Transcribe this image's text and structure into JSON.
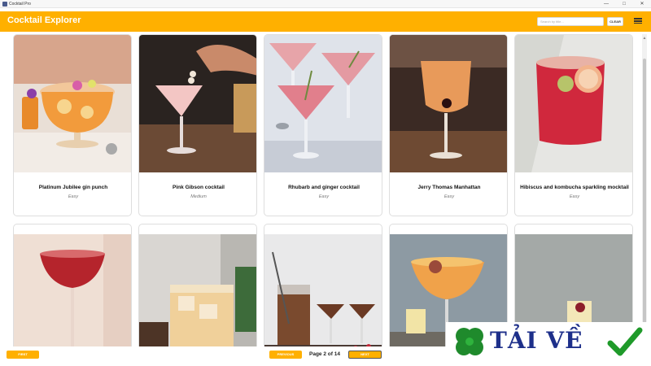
{
  "window": {
    "title": "Cocktail Pro"
  },
  "header": {
    "title": "Cocktail Explorer",
    "search_placeholder": "Search by title...",
    "clear_label": "CLEAR"
  },
  "cards": [
    {
      "name": "Platinum Jubilee gin punch",
      "difficulty": "Easy"
    },
    {
      "name": "Pink Gibson cocktail",
      "difficulty": "Medium"
    },
    {
      "name": "Rhubarb and ginger cocktail",
      "difficulty": "Easy"
    },
    {
      "name": "Jerry Thomas Manhattan",
      "difficulty": "Easy"
    },
    {
      "name": "Hibiscus and kombucha sparkling mocktail",
      "difficulty": "Easy"
    }
  ],
  "footer": {
    "first_label": "FIRST",
    "previous_label": "PREVIOUS",
    "page_info": "Page 2 of 14",
    "next_label": "NEXT"
  },
  "banner": {
    "text": "TẢI VỀ"
  },
  "colors": {
    "accent": "#ffb000",
    "banner_text": "#1d2f8a",
    "check": "#1f9a2a"
  },
  "icons": [
    "app-icon",
    "minimize-icon",
    "maximize-icon",
    "close-icon",
    "menu-icon",
    "clover-icon",
    "checkmark-icon"
  ]
}
